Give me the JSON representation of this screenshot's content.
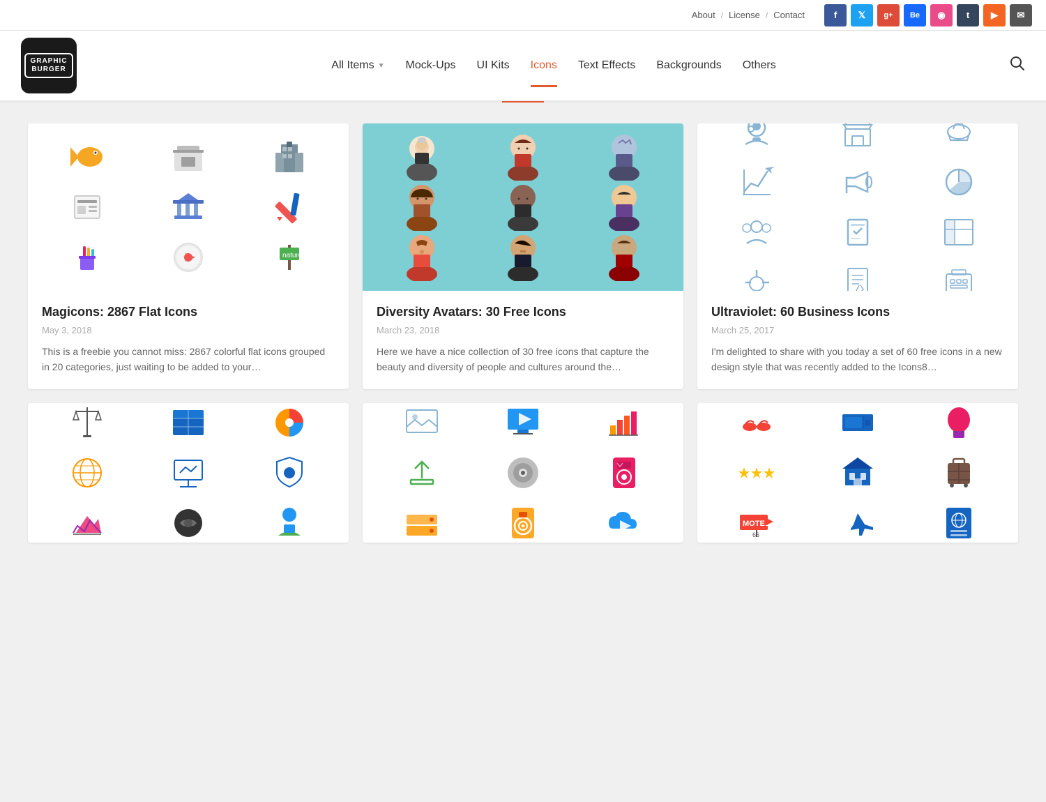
{
  "topbar": {
    "links": [
      "About",
      "License",
      "Contact"
    ],
    "separators": [
      "/",
      "/"
    ],
    "social": [
      {
        "name": "facebook",
        "label": "f",
        "class": "facebook"
      },
      {
        "name": "twitter",
        "label": "t",
        "class": "twitter"
      },
      {
        "name": "gplus",
        "label": "g+",
        "class": "gplus"
      },
      {
        "name": "behance",
        "label": "Be",
        "class": "behance"
      },
      {
        "name": "dribbble",
        "label": "◎",
        "class": "dribbble"
      },
      {
        "name": "tumblr",
        "label": "t",
        "class": "tumblr"
      },
      {
        "name": "rss",
        "label": "⊕",
        "class": "rss"
      },
      {
        "name": "email",
        "label": "✉",
        "class": "email"
      }
    ]
  },
  "logo": {
    "line1": "GRAPHIC",
    "line2": "BURGER"
  },
  "nav": {
    "items": [
      {
        "label": "All Items",
        "id": "all-items",
        "active": false,
        "dropdown": true
      },
      {
        "label": "Mock-Ups",
        "id": "mock-ups",
        "active": false,
        "dropdown": false
      },
      {
        "label": "UI Kits",
        "id": "ui-kits",
        "active": false,
        "dropdown": false
      },
      {
        "label": "Icons",
        "id": "icons",
        "active": true,
        "dropdown": false
      },
      {
        "label": "Text Effects",
        "id": "text-effects",
        "active": false,
        "dropdown": false
      },
      {
        "label": "Backgrounds",
        "id": "backgrounds",
        "active": false,
        "dropdown": false
      },
      {
        "label": "Others",
        "id": "others",
        "active": false,
        "dropdown": false
      }
    ]
  },
  "cards": [
    {
      "id": "card-1",
      "title": "Magicons: 2867 Flat Icons",
      "date": "May 3, 2018",
      "description": "This is a freebie you cannot miss: 2867 colorful flat icons grouped in 20 categories, just waiting to be added to your…",
      "bg": "light"
    },
    {
      "id": "card-2",
      "title": "Diversity Avatars: 30 Free Icons",
      "date": "March 23, 2018",
      "description": "Here we have a nice collection of 30 free icons that capture the beauty and diversity of people and cultures around the…",
      "bg": "teal"
    },
    {
      "id": "card-3",
      "title": "Ultraviolet: 60 Business Icons",
      "date": "March 25, 2017",
      "description": "I'm delighted to share with you today a set of 60 free icons in a new design style that was recently added to the Icons8…",
      "bg": "white"
    },
    {
      "id": "card-4",
      "title": "",
      "date": "",
      "description": "",
      "bg": "light"
    },
    {
      "id": "card-5",
      "title": "",
      "date": "",
      "description": "",
      "bg": "light"
    },
    {
      "id": "card-6",
      "title": "",
      "date": "",
      "description": "",
      "bg": "light"
    }
  ]
}
